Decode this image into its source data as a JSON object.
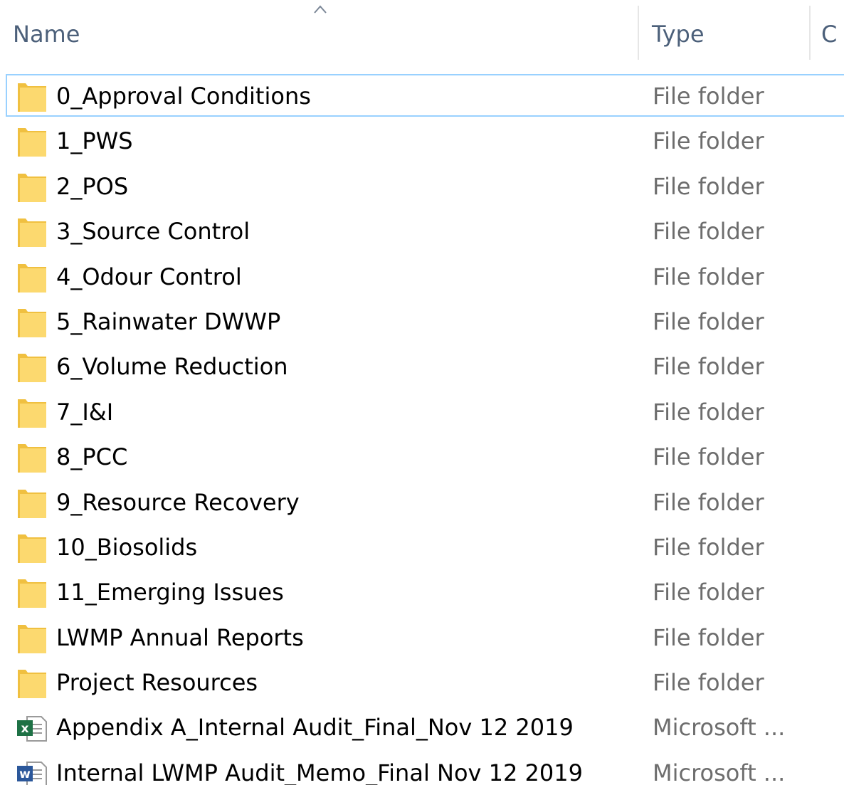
{
  "header": {
    "name_label": "Name",
    "type_label": "Type",
    "third_label": "C",
    "sort_icon": "chevron-up-icon"
  },
  "rows": [
    {
      "name": "0_Approval Conditions",
      "type": "File folder",
      "icon": "folder-icon"
    },
    {
      "name": "1_PWS",
      "type": "File folder",
      "icon": "folder-icon"
    },
    {
      "name": "2_POS",
      "type": "File folder",
      "icon": "folder-icon"
    },
    {
      "name": "3_Source Control",
      "type": "File folder",
      "icon": "folder-icon"
    },
    {
      "name": "4_Odour Control",
      "type": "File folder",
      "icon": "folder-icon"
    },
    {
      "name": "5_Rainwater DWWP",
      "type": "File folder",
      "icon": "folder-icon"
    },
    {
      "name": "6_Volume Reduction",
      "type": "File folder",
      "icon": "folder-icon"
    },
    {
      "name": "7_I&I",
      "type": "File folder",
      "icon": "folder-icon"
    },
    {
      "name": "8_PCC",
      "type": "File folder",
      "icon": "folder-icon"
    },
    {
      "name": "9_Resource Recovery",
      "type": "File folder",
      "icon": "folder-icon"
    },
    {
      "name": "10_Biosolids",
      "type": "File folder",
      "icon": "folder-icon"
    },
    {
      "name": "11_Emerging Issues",
      "type": "File folder",
      "icon": "folder-icon"
    },
    {
      "name": "LWMP Annual Reports",
      "type": "File folder",
      "icon": "folder-icon"
    },
    {
      "name": "Project Resources",
      "type": "File folder",
      "icon": "folder-icon"
    },
    {
      "name": "Appendix A_Internal Audit_Final_Nov 12 2019",
      "type": "Microsoft ...",
      "icon": "excel-file-icon"
    },
    {
      "name": "Internal LWMP Audit_Memo_Final Nov 12 2019",
      "type": "Microsoft ...",
      "icon": "word-file-icon"
    }
  ],
  "colors": {
    "folder_fill": "#fcd96f",
    "folder_shade": "#f0c040",
    "selection_border": "#99d1ff",
    "header_text": "#4c607a",
    "type_text": "#6d6d6d",
    "excel_green": "#1e7145",
    "word_blue": "#2b579a"
  }
}
